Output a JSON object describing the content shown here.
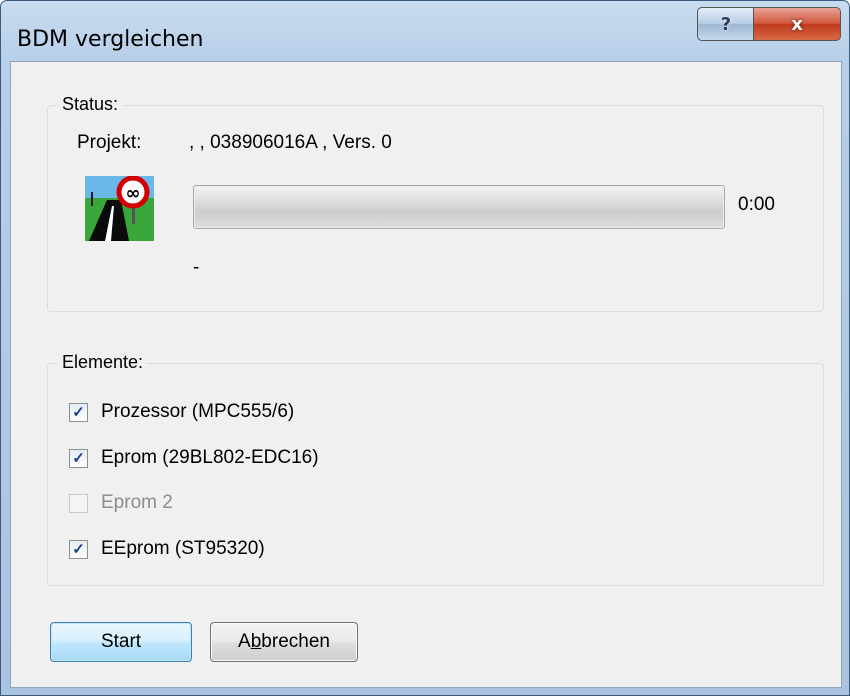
{
  "window": {
    "title": "BDM vergleichen",
    "help_label": "?",
    "close_label": "x"
  },
  "status": {
    "group_label": "Status:",
    "project_label": "Projekt:",
    "project_value": ", , 038906016A , Vers. 0",
    "progress_percent": 0,
    "time": "0:00",
    "message": "-"
  },
  "elements": {
    "group_label": "Elemente:",
    "items": [
      {
        "label": "Prozessor (MPC555/6)",
        "checked": true,
        "enabled": true
      },
      {
        "label": "Eprom (29BL802-EDC16)",
        "checked": true,
        "enabled": true
      },
      {
        "label": "Eprom 2",
        "checked": false,
        "enabled": false
      },
      {
        "label": "EEprom (ST95320)",
        "checked": true,
        "enabled": true
      }
    ]
  },
  "buttons": {
    "start": "Start",
    "cancel_prefix": "A",
    "cancel_mnemonic": "b",
    "cancel_rest": "brechen"
  },
  "icons": {
    "status_icon": "road-infinity-sign-icon",
    "check_icon": "checkmark-icon"
  },
  "colors": {
    "title_bar": "#b7cfe9",
    "close_button": "#c13a1e",
    "start_button_border": "#3c7fb1",
    "sign_red": "#d40000"
  }
}
